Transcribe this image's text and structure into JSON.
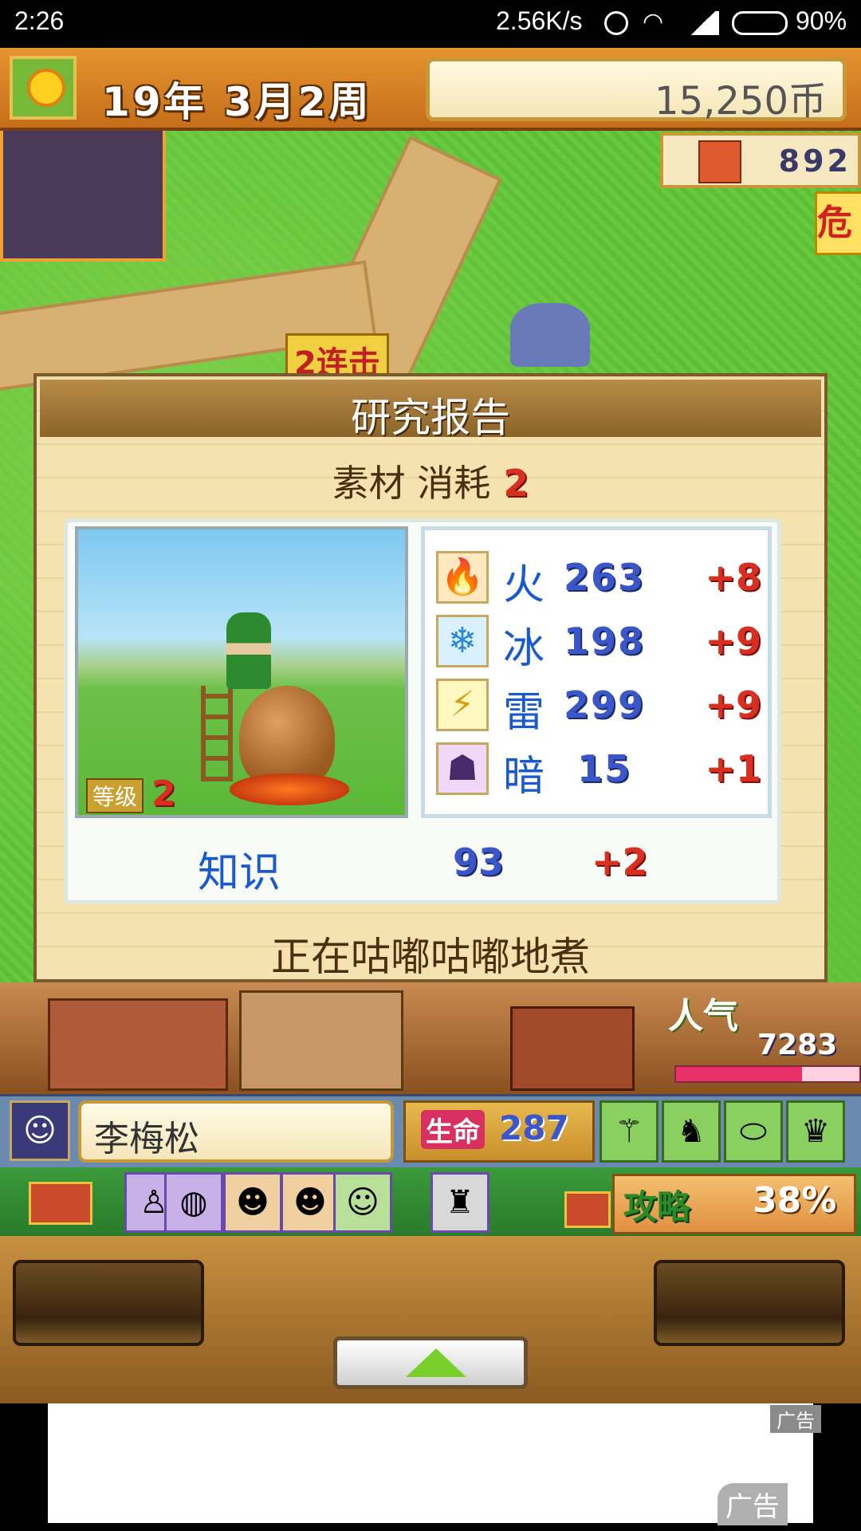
{
  "status_bar": {
    "time": "2:26",
    "net_speed": "2.56K/s",
    "battery": "90%"
  },
  "top_bar": {
    "date": "19年 3月2周",
    "money": "15,250币",
    "population": "892",
    "danger_label": "危"
  },
  "map": {
    "combo_label": "2连击"
  },
  "dialog": {
    "title": "研究报告",
    "material_label": "素材 消耗",
    "material_count": "2",
    "level_label": "等级",
    "level_value": "2",
    "stats": [
      {
        "icon": "fire-icon",
        "glyph": "🔥",
        "label": "火",
        "value": "263",
        "delta": "+8",
        "color": "#ff6a1a"
      },
      {
        "icon": "ice-icon",
        "glyph": "❄",
        "label": "冰",
        "value": "198",
        "delta": "+9",
        "color": "#4aa8e8"
      },
      {
        "icon": "thunder-icon",
        "glyph": "⚡",
        "label": "雷",
        "value": "299",
        "delta": "+9",
        "color": "#e8c020"
      },
      {
        "icon": "dark-icon",
        "glyph": "☗",
        "label": "暗",
        "value": "15",
        "delta": "+1",
        "color": "#6a3a8a"
      }
    ],
    "knowledge_label": "知识",
    "knowledge_value": "93",
    "knowledge_delta": "+2",
    "footer": "正在咕嘟咕嘟地煮"
  },
  "town": {
    "popularity_label": "人气",
    "popularity_value": "7283",
    "popularity_fill": 0.7
  },
  "hero": {
    "name": "李梅松",
    "hp_label": "生命",
    "hp_value": "287"
  },
  "party": {
    "strategy_label": "攻略",
    "strategy_value": "38%"
  },
  "ad": {
    "tag": "广告",
    "tag2": "广告"
  }
}
